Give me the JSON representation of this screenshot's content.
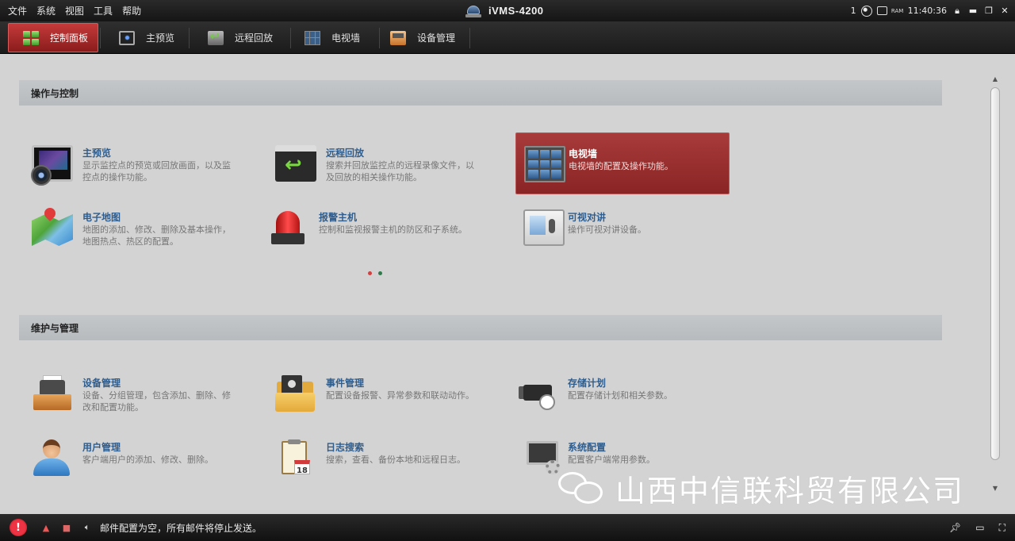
{
  "menu": [
    "文件",
    "系统",
    "视图",
    "工具",
    "帮助"
  ],
  "app": {
    "title": "iVMS-4200"
  },
  "sysbar": {
    "count": "1",
    "ram_label": "RAM",
    "time": "11:40:36"
  },
  "tabs": [
    {
      "label": "控制面板",
      "icon": "control-panel-icon",
      "active": true
    },
    {
      "label": "主预览",
      "icon": "main-preview-icon"
    },
    {
      "label": "远程回放",
      "icon": "remote-playback-icon"
    },
    {
      "label": "电视墙",
      "icon": "video-wall-icon"
    },
    {
      "label": "设备管理",
      "icon": "device-management-icon"
    }
  ],
  "sections": {
    "operation": {
      "title": "操作与控制",
      "cards": [
        {
          "title": "主预览",
          "desc": "显示监控点的预览或回放画面，以及监控点的操作功能。",
          "icon": "monitor-camera-icon"
        },
        {
          "title": "远程回放",
          "desc": "搜索并回放监控点的远程录像文件，以及回放的相关操作功能。",
          "icon": "clapperboard-icon"
        },
        {
          "title": "电视墙",
          "desc": "电视墙的配置及操作功能。",
          "icon": "video-wall-icon",
          "selected": true
        },
        {
          "title": "电子地图",
          "desc": "地图的添加、修改、删除及基本操作，地图热点、热区的配置。",
          "icon": "map-icon"
        },
        {
          "title": "报警主机",
          "desc": "控制和监视报警主机的防区和子系统。",
          "icon": "alarm-siren-icon"
        },
        {
          "title": "可视对讲",
          "desc": "操作可视对讲设备。",
          "icon": "video-intercom-icon"
        }
      ]
    },
    "maintenance": {
      "title": "维护与管理",
      "cards": [
        {
          "title": "设备管理",
          "desc": "设备、分组管理，包含添加、删除、修改和配置功能。",
          "icon": "fax-device-icon"
        },
        {
          "title": "事件管理",
          "desc": "配置设备报警、异常参数和联动动作。",
          "icon": "event-folder-icon"
        },
        {
          "title": "存储计划",
          "desc": "配置存储计划和相关参数。",
          "icon": "camcorder-clock-icon"
        },
        {
          "title": "用户管理",
          "desc": "客户端用户的添加、修改、删除。",
          "icon": "user-icon"
        },
        {
          "title": "日志搜索",
          "desc": "搜索，查看、备份本地和远程日志。",
          "icon": "log-calendar-icon"
        },
        {
          "title": "系统配置",
          "desc": "配置客户端常用参数。",
          "icon": "system-config-icon"
        }
      ]
    }
  },
  "calendar_day": "18",
  "watermark": {
    "text": "山西中信联科贸有限公司"
  },
  "status": {
    "message": "邮件配置为空，所有邮件将停止发送。"
  },
  "colors": {
    "accent_red": "#a83a3a",
    "title_blue": "#2e5d8e",
    "section_bg": "#bdc1c4"
  }
}
